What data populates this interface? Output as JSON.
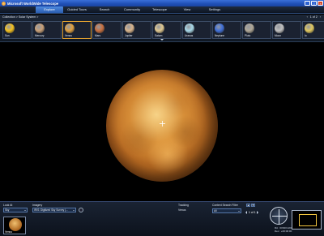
{
  "window": {
    "title": "Microsoft WorldWide Telescope",
    "pager_text": "1 of 2"
  },
  "tabs": [
    "Explore",
    "Guided Tours",
    "Search",
    "Community",
    "Telescope",
    "View",
    "Settings"
  ],
  "explorer": {
    "breadcrumb": "Collection > Solar System >",
    "items": [
      {
        "label": "Sun",
        "color": "#f3c020"
      },
      {
        "label": "Mercury",
        "color": "#c8a078"
      },
      {
        "label": "Venus",
        "color": "#e0a040"
      },
      {
        "label": "Mars",
        "color": "#c87040"
      },
      {
        "label": "Jupiter",
        "color": "#d8b48c"
      },
      {
        "label": "Saturn",
        "color": "#e0c890"
      },
      {
        "label": "Uranus",
        "color": "#a8d8e8"
      },
      {
        "label": "Neptune",
        "color": "#4070d8"
      },
      {
        "label": "Pluto",
        "color": "#b0a898"
      },
      {
        "label": "Moon",
        "color": "#c0c0c0"
      },
      {
        "label": "Io",
        "color": "#e0c860"
      }
    ]
  },
  "bottom": {
    "look_at_label": "Look At",
    "look_at_value": "Sky",
    "imagery_label": "Imagery",
    "imagery_value": "IRIS: Digitized Sky Survey (...",
    "tracking_label": "Tracking",
    "tracking_value": "Venus",
    "context_label": "Context Search Filter",
    "context_value": "All",
    "page_text": "1 of 1",
    "thumb_label": "Venus",
    "ra": "RA : 00h00m00s",
    "dec": "Dec : +00:00:00"
  }
}
